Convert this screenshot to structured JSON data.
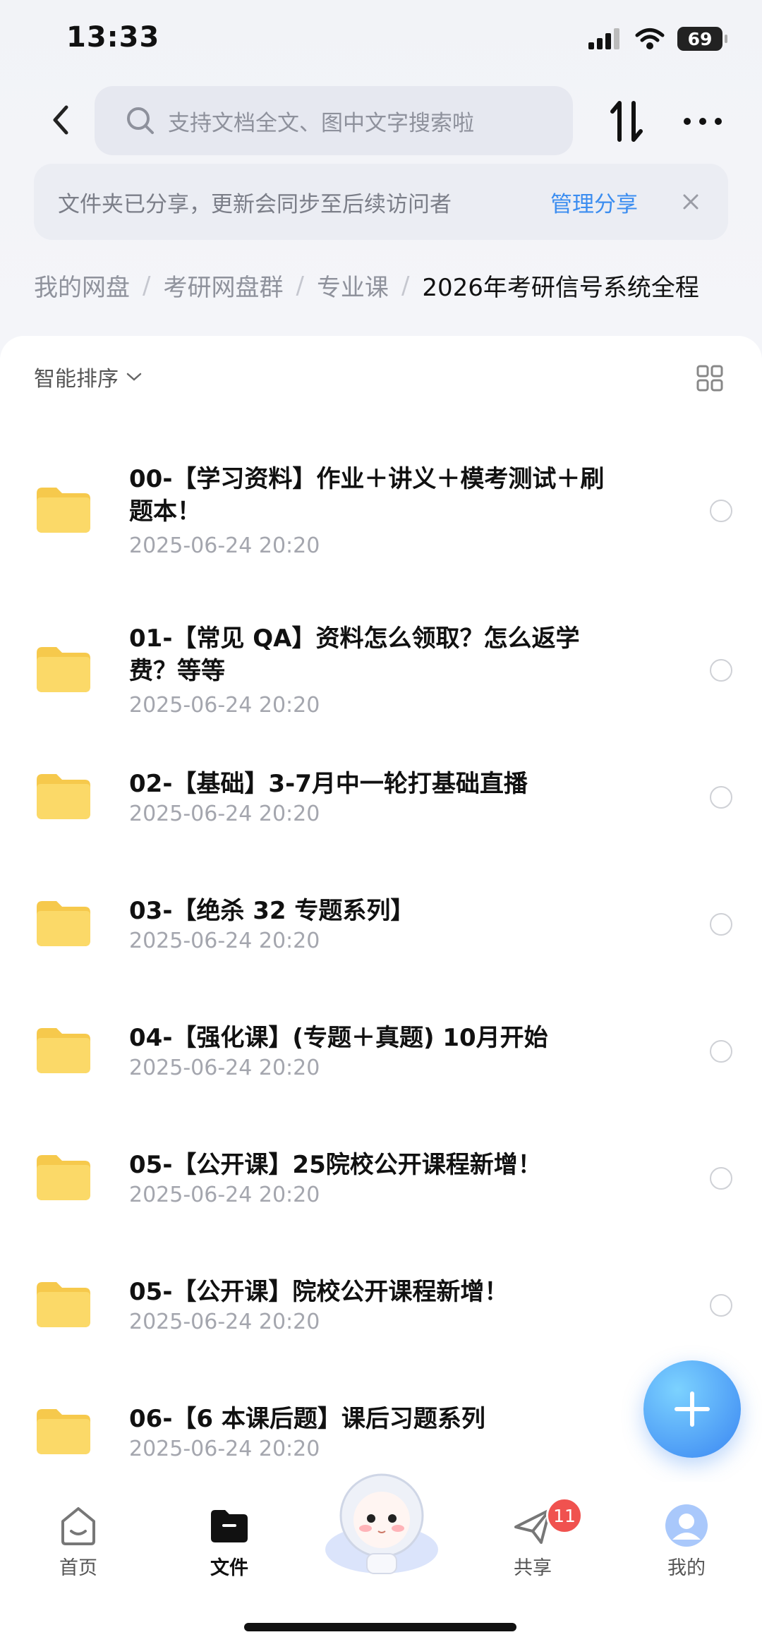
{
  "status_bar": {
    "time": "13:33",
    "battery": "69"
  },
  "search": {
    "placeholder": "支持文档全文、图中文字搜索啦"
  },
  "banner": {
    "text": "文件夹已分享，更新会同步至后续访问者",
    "link": "管理分享"
  },
  "breadcrumb": [
    "我的网盘",
    "考研网盘群",
    "专业课",
    "2026年考研信号系统全程"
  ],
  "sort_label": "智能排序",
  "files": [
    {
      "title": "00-【学习资料】作业＋讲义＋模考测试＋刷题本！",
      "date": "2025-06-24 20:20"
    },
    {
      "title": "01-【常见 QA】资料怎么领取？怎么返学费？等等",
      "date": "2025-06-24 20:20"
    },
    {
      "title": "02-【基础】3-7月中一轮打基础直播",
      "date": "2025-06-24 20:20"
    },
    {
      "title": "03-【绝杀 32 专题系列】",
      "date": "2025-06-24 20:20"
    },
    {
      "title": "04-【强化课】(专题＋真题) 10月开始",
      "date": "2025-06-24 20:20"
    },
    {
      "title": "05-【公开课】25院校公开课程新增！",
      "date": "2025-06-24 20:20"
    },
    {
      "title": "05-【公开课】院校公开课程新增！",
      "date": "2025-06-24 20:20"
    },
    {
      "title": "06-【6 本课后题】课后习题系列",
      "date": "2025-06-24 20:20"
    }
  ],
  "tabs": [
    {
      "label": "首页",
      "icon": "home-icon"
    },
    {
      "label": "文件",
      "icon": "folder-icon"
    },
    {
      "label": "共享",
      "icon": "share-icon",
      "badge": "11"
    },
    {
      "label": "我的",
      "icon": "profile-icon"
    }
  ],
  "colors": {
    "accent": "#3b8df0",
    "folder": "#fbd562",
    "badge": "#f0524f"
  }
}
